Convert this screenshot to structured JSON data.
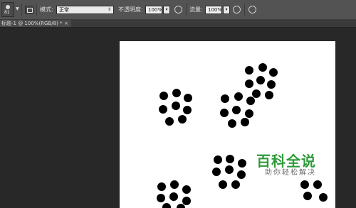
{
  "options_bar": {
    "brush_size": "81",
    "mode_label": "模式:",
    "mode_value": "正常",
    "opacity_label": "不透明度:",
    "opacity_value": "100%",
    "flow_label": "流量:",
    "flow_value": "100%"
  },
  "document_tab": {
    "title": "标题-1 @ 100%(RGB/8) *",
    "close_label": "×"
  },
  "watermark": {
    "main": "百科全说",
    "sub": "助你轻松解决",
    "color": "#2f9a3a"
  }
}
